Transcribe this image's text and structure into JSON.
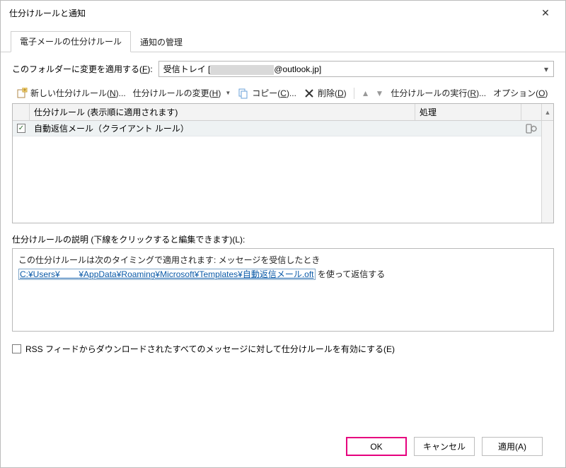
{
  "window": {
    "title": "仕分けルールと通知"
  },
  "tabs": {
    "rules": "電子メールの仕分けルール",
    "notify": "通知の管理"
  },
  "folder": {
    "label_pre": "このフォルダーに変更を適用する(",
    "label_key": "F",
    "label_post": "):",
    "value_pre": "受信トレイ [",
    "value_post": "@outlook.jp]"
  },
  "toolbar": {
    "new_pre": "新しい仕分けルール(",
    "new_key": "N",
    "new_post": ")...",
    "change_pre": "仕分けルールの変更(",
    "change_key": "H",
    "change_post": ")",
    "copy_pre": "コピー(",
    "copy_key": "C",
    "copy_post": ")...",
    "delete_pre": "削除(",
    "delete_key": "D",
    "delete_post": ")",
    "run_pre": "仕分けルールの実行(",
    "run_key": "R",
    "run_post": ")...",
    "options_pre": "オプション(",
    "options_key": "O",
    "options_post": ")"
  },
  "table": {
    "col_rule": "仕分けルール (表示順に適用されます)",
    "col_proc": "処理",
    "rows": [
      {
        "name": "自動返信メール（クライアント ルール）",
        "checked": true
      }
    ]
  },
  "desc": {
    "label": "仕分けルールの説明 (下線をクリックすると編集できます)(L):",
    "line1": "この仕分けルールは次のタイミングで適用されます: メッセージを受信したとき",
    "path_pre": "C:¥Users¥",
    "path_post": "¥AppData¥Roaming¥Microsoft¥Templates¥自動返信メール.oft",
    "line2_post": " を使って返信する"
  },
  "rss": {
    "label": "RSS フィードからダウンロードされたすべてのメッセージに対して仕分けルールを有効にする(E)"
  },
  "buttons": {
    "ok": "OK",
    "cancel": "キャンセル",
    "apply": "適用(A)"
  }
}
